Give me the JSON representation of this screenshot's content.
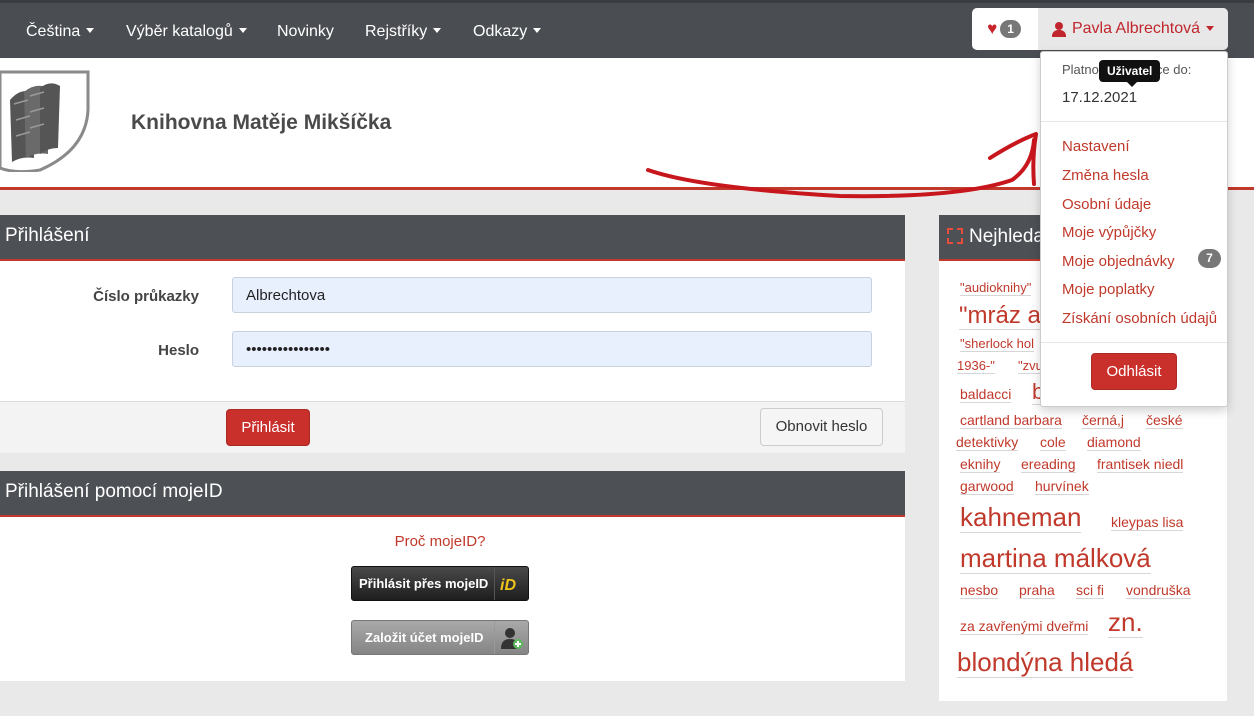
{
  "nav": {
    "language": "Čeština",
    "catalog": "Výběr katalogů",
    "news": "Novinky",
    "registers": "Rejstříky",
    "links": "Odkazy",
    "favorites_count": "1",
    "user_name": "Pavla Albrechtová"
  },
  "header": {
    "library_name": "Knihovna Matěje Mikšíčka"
  },
  "login": {
    "title": "Přihlášení",
    "card_label": "Číslo průkazky",
    "card_value": "Albrechtova",
    "password_label": "Heslo",
    "password_value": "••••••••••••••••",
    "submit": "Přihlásit",
    "reset": "Obnovit heslo"
  },
  "mojeid": {
    "title": "Přihlášení pomocí mojeID",
    "why": "Proč mojeID?",
    "login_button": "Přihlásit přes mojeID",
    "create_button": "Založit účet mojeID"
  },
  "cloud": {
    "title": "Nejhleda",
    "tags": [
      "\"audioknihy\"",
      "\"mráz a",
      "\"sherlock hol",
      "1936-\"",
      "\"zvu",
      "baldacci",
      "b",
      "cartland barbara",
      "černá,j",
      "české",
      "detektivky",
      "cole",
      "diamond",
      "eknihy",
      "ereading",
      "frantisek niedl",
      "garwood",
      "hurvínek",
      "kahneman",
      "kleypas lisa",
      "martina málková",
      "nesbo",
      "praha",
      "sci fi",
      "vondruška",
      "za zavřenými dveřmi",
      "zn.",
      "blondýna hledá"
    ]
  },
  "dropdown": {
    "valid_label": "Platnost registrace do:",
    "valid_date": "17.12.2021",
    "tooltip": "Uživatel",
    "items": [
      "Nastavení",
      "Změna hesla",
      "Osobní údaje",
      "Moje výpůjčky",
      "Moje objednávky",
      "Moje poplatky",
      "Získání osobních údajů"
    ],
    "orders_count": "7",
    "logout": "Odhlásit"
  },
  "colors": {
    "accent": "#c0392b",
    "nav_bg": "#4a4d52"
  }
}
